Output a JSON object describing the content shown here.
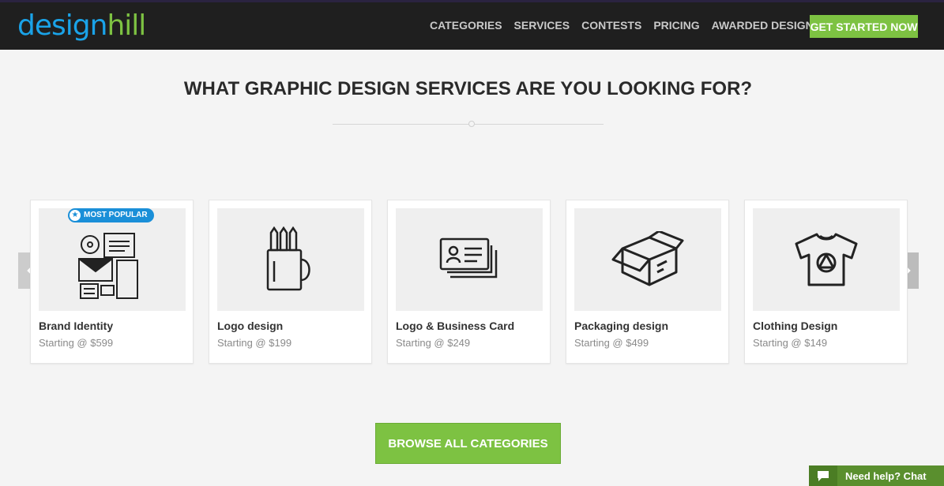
{
  "header": {
    "logo_part1": "design",
    "logo_part2": "hill",
    "nav": [
      "CATEGORIES",
      "SERVICES",
      "CONTESTS",
      "PRICING",
      "AWARDED DESIGNS"
    ],
    "cta": "GET STARTED NOW"
  },
  "main": {
    "title": "WHAT GRAPHIC DESIGN SERVICES ARE YOU LOOKING FOR?",
    "badge": "MOST POPULAR",
    "cards": [
      {
        "name": "Brand Identity",
        "price": "Starting @ $599"
      },
      {
        "name": "Logo design",
        "price": "Starting @ $199"
      },
      {
        "name": "Logo & Business Card",
        "price": "Starting @ $249"
      },
      {
        "name": "Packaging design",
        "price": "Starting @ $499"
      },
      {
        "name": "Clothing Design",
        "price": "Starting @ $149"
      }
    ],
    "browse": "BROWSE ALL CATEGORIES"
  },
  "chat": {
    "label": "Need help? Chat"
  },
  "icons": {
    "prev": "chevron-left-icon",
    "next": "chevron-right-icon",
    "chat": "chat-bubble-icon"
  },
  "colors": {
    "brand_blue": "#1aa3e8",
    "brand_green": "#7dc242",
    "header_bg": "#1f1f1f"
  }
}
